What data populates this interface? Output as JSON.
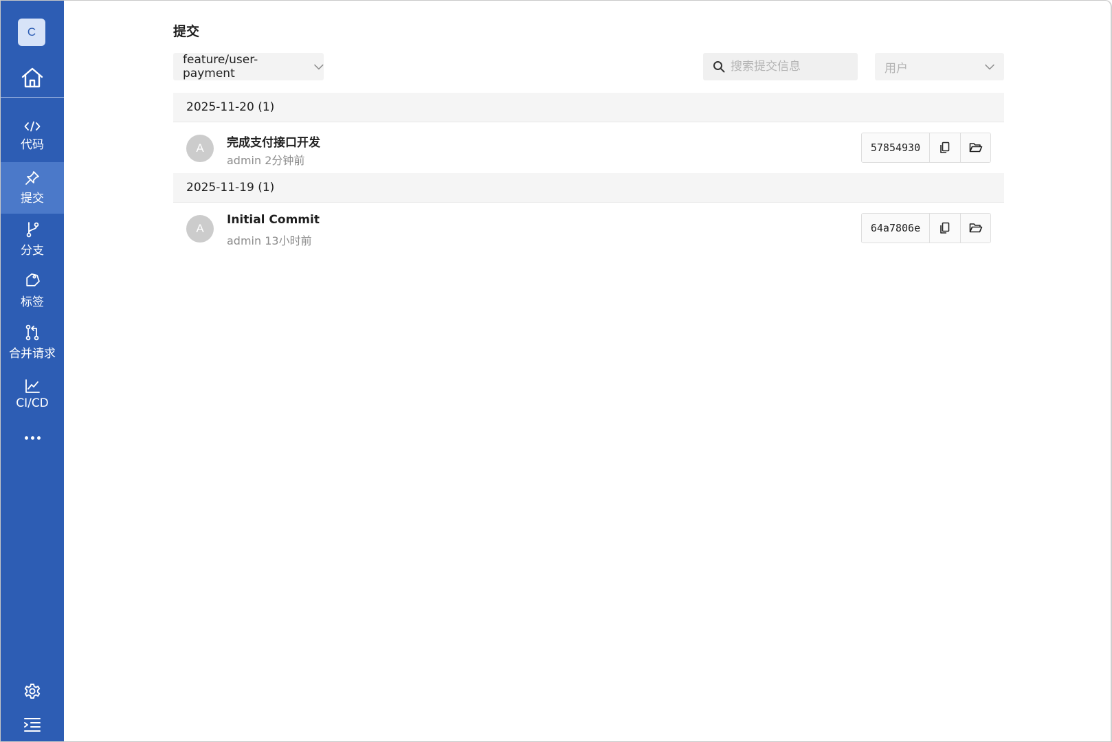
{
  "sidebar": {
    "logo_letter": "C",
    "home_icon": "home-icon",
    "items": [
      {
        "label": "代码",
        "icon": "code-icon",
        "active": false
      },
      {
        "label": "提交",
        "icon": "pin-icon",
        "active": true
      },
      {
        "label": "分支",
        "icon": "branch-icon",
        "active": false
      },
      {
        "label": "标签",
        "icon": "tag-icon",
        "active": false
      },
      {
        "label": "合并请求",
        "icon": "merge-request-icon",
        "active": false
      },
      {
        "label": "CI/CD",
        "icon": "chart-line-icon",
        "active": false
      }
    ],
    "more_icon": "more-icon",
    "settings_icon": "gear-icon",
    "collapse_icon": "collapse-menu-icon",
    "colors": {
      "background": "#2d5db4",
      "active": "#4b79c9"
    }
  },
  "page": {
    "title": "提交"
  },
  "filters": {
    "branch": "feature/user-payment",
    "search_placeholder": "搜索提交信息",
    "search_value": "",
    "user_placeholder": "用户"
  },
  "groups": [
    {
      "date_label": "2025-11-20 (1)",
      "commits": [
        {
          "avatar": "A",
          "message": "完成支付接口开发",
          "meta": "admin 2分钟前",
          "sha": "57854930"
        }
      ]
    },
    {
      "date_label": "2025-11-19 (1)",
      "commits": [
        {
          "avatar": "A",
          "message": "Initial Commit",
          "meta": "admin 13小时前",
          "sha": "64a7806e"
        }
      ]
    }
  ]
}
